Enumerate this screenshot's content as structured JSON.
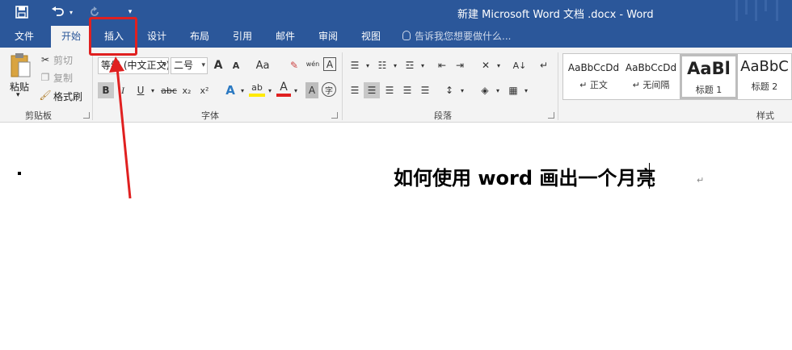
{
  "window": {
    "title": "新建 Microsoft Word 文档 .docx - Word"
  },
  "quick_access": {
    "save_icon": "save-icon",
    "undo_icon": "undo-icon",
    "redo_icon": "redo-icon",
    "customize_icon": "customize-icon"
  },
  "tabs": [
    {
      "label": "文件"
    },
    {
      "label": "开始"
    },
    {
      "label": "插入"
    },
    {
      "label": "设计"
    },
    {
      "label": "布局"
    },
    {
      "label": "引用"
    },
    {
      "label": "邮件"
    },
    {
      "label": "审阅"
    },
    {
      "label": "视图"
    }
  ],
  "tell_me": {
    "placeholder": "告诉我您想要做什么..."
  },
  "clipboard": {
    "paste": "粘贴",
    "cut": "剪切",
    "copy": "复制",
    "format_painter": "格式刷",
    "group_label": "剪贴板"
  },
  "font": {
    "font_name": "等线 (中文正文)",
    "font_size": "二号",
    "group_label": "字体",
    "bold": "B",
    "italic": "I",
    "underline": "U",
    "strike": "abc",
    "subscript": "x₂",
    "superscript": "x²",
    "grow": "A",
    "shrink": "A",
    "change_case": "Aa",
    "phonetic": "wén",
    "border_char": "A",
    "enclose_char": "字",
    "shade_char": "A",
    "color_a": "A"
  },
  "paragraph": {
    "group_label": "段落"
  },
  "styles": {
    "group_label": "样式",
    "items": [
      {
        "preview": "AaBbCcDd",
        "name": "↵ 正文"
      },
      {
        "preview": "AaBbCcDd",
        "name": "↵ 无间隔"
      },
      {
        "preview": "AaBl",
        "name": "标题 1"
      },
      {
        "preview": "AaBbC",
        "name": "标题 2"
      }
    ]
  },
  "document": {
    "title": "如何使用 word 画出一个月亮",
    "para_mark": "↵"
  },
  "colors": {
    "accent": "#2b579a",
    "annotation": "#e02020"
  }
}
